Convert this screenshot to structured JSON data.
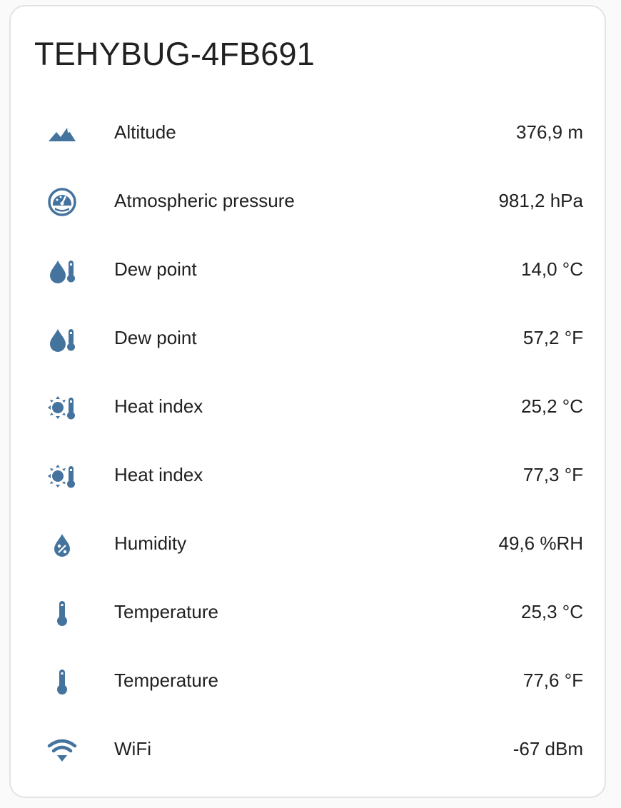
{
  "colors": {
    "icon": "#44739e",
    "text": "#212121",
    "card_border": "#e3e3e3",
    "background": "#fafafa"
  },
  "card": {
    "title": "TEHYBUG-4FB691"
  },
  "entities": [
    {
      "icon": "mountain-icon",
      "name": "Altitude",
      "value": "376,9 m"
    },
    {
      "icon": "gauge-icon",
      "name": "Atmospheric pressure",
      "value": "981,2 hPa"
    },
    {
      "icon": "water-thermometer-icon",
      "name": "Dew point",
      "value": "14,0 °C"
    },
    {
      "icon": "water-thermometer-icon",
      "name": "Dew point",
      "value": "57,2 °F"
    },
    {
      "icon": "sun-thermometer-icon",
      "name": "Heat index",
      "value": "25,2 °C"
    },
    {
      "icon": "sun-thermometer-icon",
      "name": "Heat index",
      "value": "77,3 °F"
    },
    {
      "icon": "water-percent-icon",
      "name": "Humidity",
      "value": "49,6 %RH"
    },
    {
      "icon": "thermometer-icon",
      "name": "Temperature",
      "value": "25,3 °C"
    },
    {
      "icon": "thermometer-icon",
      "name": "Temperature",
      "value": "77,6 °F"
    },
    {
      "icon": "wifi-icon",
      "name": "WiFi",
      "value": "-67 dBm"
    }
  ]
}
